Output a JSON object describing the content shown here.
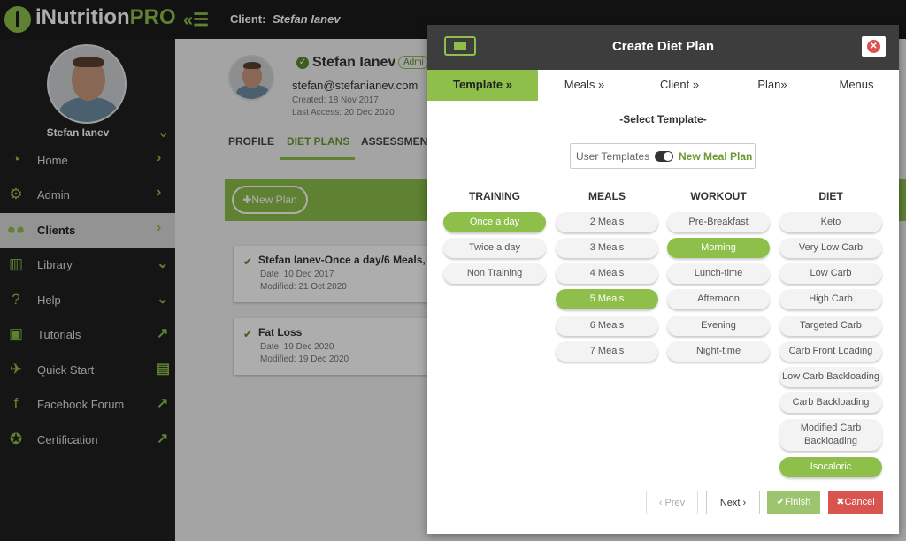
{
  "app": {
    "logo_main": "iNutrition",
    "logo_accent": "PRO"
  },
  "topbar": {
    "client_label": "Client:",
    "client_name": "Stefan Ianev"
  },
  "sidebar": {
    "user_name": "Stefan Ianev",
    "items": [
      {
        "label": "Home",
        "icon": "dashboard-icon"
      },
      {
        "label": "Admin",
        "icon": "admin-icon"
      },
      {
        "label": "Clients",
        "icon": "clients-icon"
      },
      {
        "label": "Library",
        "icon": "library-icon"
      },
      {
        "label": "Help",
        "icon": "help-icon"
      },
      {
        "label": "Tutorials",
        "icon": "tutorials-icon"
      },
      {
        "label": "Quick Start",
        "icon": "rocket-icon"
      },
      {
        "label": "Facebook Forum",
        "icon": "facebook-icon"
      },
      {
        "label": "Certification",
        "icon": "certificate-icon"
      }
    ]
  },
  "client": {
    "name": "Stefan Ianev",
    "badge": "Admi",
    "email": "stefan@stefanianev.com",
    "created": "Created: 18 Nov 2017",
    "last_access": "Last Access: 20 Dec 2020",
    "tabs": [
      "PROFILE",
      "DIET PLANS",
      "ASSESSMEN"
    ],
    "new_plan": "New Plan",
    "plans": [
      {
        "title": "Stefan Ianev-Once a day/6 Meals,",
        "date": "Date:    10 Dec 2017",
        "modified": "Modified: 21 Oct 2020"
      },
      {
        "title": "Fat Loss",
        "date": "Date:    19 Dec 2020",
        "modified": "Modified: 19 Dec 2020"
      }
    ]
  },
  "modal": {
    "title": "Create Diet Plan",
    "steps": [
      "Template",
      "Meals",
      "Client",
      "Plan",
      "Menus"
    ],
    "subtitle": "-Select Template-",
    "toggle_left": "User Templates",
    "toggle_right": "New Meal Plan",
    "columns": {
      "training": {
        "header": "TRAINING",
        "options": [
          "Once a day",
          "Twice a day",
          "Non Training"
        ],
        "selected": "Once a day"
      },
      "meals": {
        "header": "MEALS",
        "options": [
          "2 Meals",
          "3 Meals",
          "4 Meals",
          "5 Meals",
          "6 Meals",
          "7 Meals"
        ],
        "selected": "5 Meals"
      },
      "workout": {
        "header": "WORKOUT",
        "options": [
          "Pre-Breakfast",
          "Morning",
          "Lunch-time",
          "Afternoon",
          "Evening",
          "Night-time"
        ],
        "selected": "Morning"
      },
      "diet": {
        "header": "DIET",
        "options": [
          "Keto",
          "Very Low Carb",
          "Low Carb",
          "High Carb",
          "Targeted Carb",
          "Carb Front Loading",
          "Low Carb Backloading",
          "Carb Backloading",
          "Modified Carb Backloading",
          "Isocaloric"
        ],
        "selected": "Isocaloric"
      }
    },
    "footer": {
      "prev": "Prev",
      "next": "Next",
      "finish": "Finish",
      "cancel": "Cancel"
    }
  },
  "colors": {
    "accent": "#8dbf4a",
    "cancel": "#d9534f",
    "dark": "#1f1f1f"
  }
}
